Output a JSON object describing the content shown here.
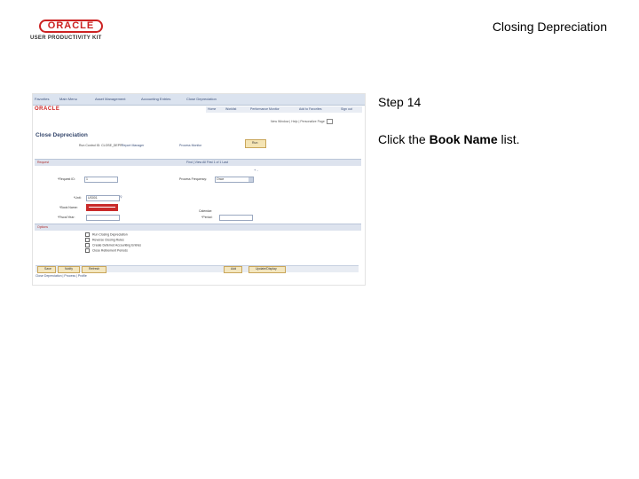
{
  "logo": {
    "brand": "ORACLE",
    "product": "USER PRODUCTIVITY KIT"
  },
  "slide": {
    "title": "Closing Depreciation",
    "step": "Step 14",
    "instruction_prefix": "Click the ",
    "instruction_target": "Book Name",
    "instruction_suffix": " list."
  },
  "screenshot": {
    "breadcrumb": [
      "Favorites",
      "Main Menu",
      "Asset Management",
      "Accounting Entries",
      "Close Depreciation"
    ],
    "nav_links": [
      "Home",
      "Worklist",
      "Performance Monitor",
      "Add to Favorites",
      "Sign out"
    ],
    "oracle_logo": "ORACLE",
    "new_window": "New Window | Help | Personalize Page",
    "page_title": "Close Depreciation",
    "run_control": "Run Control ID: CLOSE_DEPR",
    "report_manager": "Report Manager",
    "process_monitor": "Process Monitor",
    "run_button": "Run",
    "section_request": "Request",
    "find_bar": "Find | View All    First  1 of 1  Last",
    "plus_minus": "+ -",
    "fields": {
      "request_id": {
        "label": "*Request ID:",
        "value": "1"
      },
      "process_frequency": {
        "label": "Process Frequency:",
        "value": "Once"
      },
      "unit": {
        "label": "*Unit:",
        "value": "US001"
      },
      "book_name": {
        "label": "*Book Name:"
      },
      "fiscal_year": {
        "label": "*Fiscal Year:"
      },
      "calendar": {
        "label": "Calendar:"
      },
      "period": {
        "label": "*Period:"
      }
    },
    "section_options": "Options",
    "checkboxes": [
      "Run Closing Depreciation",
      "Reverse Closing Rules",
      "Create Deferred Accounting Entries",
      "Close Retirement Periods"
    ],
    "bottom_buttons": {
      "save": "Save",
      "notify": "Notify",
      "refresh": "Refresh",
      "add": "Add",
      "update_display": "Update/Display"
    },
    "footer": "Close Depreciation | Process | Profile"
  }
}
